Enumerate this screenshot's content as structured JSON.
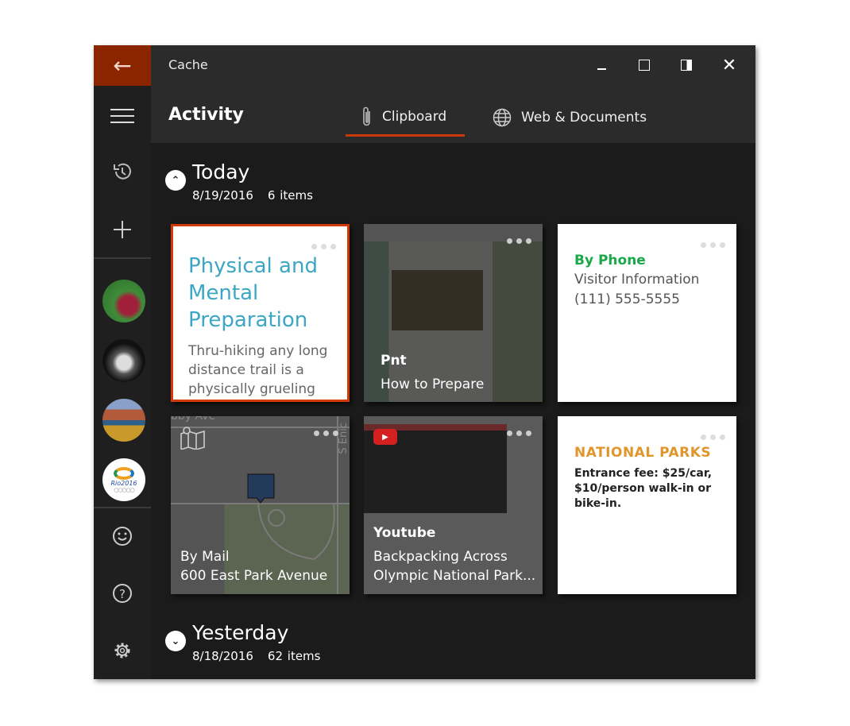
{
  "window": {
    "title": "Cache",
    "controls": [
      "minimize",
      "maximize",
      "snap",
      "close"
    ]
  },
  "sidebar": {
    "back_icon": "arrow-left-icon",
    "items": [
      {
        "name": "menu",
        "icon": "hamburger-icon"
      },
      {
        "name": "history",
        "icon": "history-icon"
      },
      {
        "name": "add",
        "icon": "plus-icon"
      }
    ],
    "avatars": [
      {
        "name": "radishes"
      },
      {
        "name": "person"
      },
      {
        "name": "mountains"
      },
      {
        "name": "rio2016",
        "logo_text": "Rio2016"
      }
    ],
    "bottom": [
      {
        "name": "feedback",
        "icon": "smiley-icon"
      },
      {
        "name": "help",
        "icon": "help-icon"
      },
      {
        "name": "settings",
        "icon": "gear-icon"
      }
    ]
  },
  "header": {
    "title": "Activity",
    "tabs": [
      {
        "label": "Clipboard",
        "icon": "paperclip-icon",
        "active": true
      },
      {
        "label": "Web & Documents",
        "icon": "globe-icon",
        "active": false
      }
    ]
  },
  "accent": "#c8380a",
  "groups": [
    {
      "title": "Today",
      "date": "8/19/2016",
      "count": "6 items",
      "expanded": true
    },
    {
      "title": "Yesterday",
      "date": "8/18/2016",
      "count": "62 items",
      "expanded": false
    }
  ],
  "cards": [
    {
      "type": "text",
      "title": "Physical and Mental Preparation",
      "body": "Thru-hiking any long distance trail is a physically grueling",
      "title_color": "#3ba7c4",
      "selected": true
    },
    {
      "type": "web",
      "source": "Pnt",
      "title": "How to Prepare"
    },
    {
      "type": "contact",
      "title": "By Phone",
      "line1": "Visitor Information",
      "line2": "(111) 555-5555",
      "title_color": "#1aa84a"
    },
    {
      "type": "map",
      "title": "By Mail",
      "address": "600 East Park Avenue",
      "icon": "map-icon",
      "street_labels": [
        "bby Ave",
        "S Enic"
      ]
    },
    {
      "type": "video",
      "source": "Youtube",
      "title": "Backpacking Across Olympic National Park...",
      "icon": "youtube-icon"
    },
    {
      "type": "note",
      "title": "NATIONAL PARKS",
      "body": "Entrance fee: $25/car, $10/person walk-in or bike-in.",
      "title_color": "#e0962a"
    }
  ]
}
